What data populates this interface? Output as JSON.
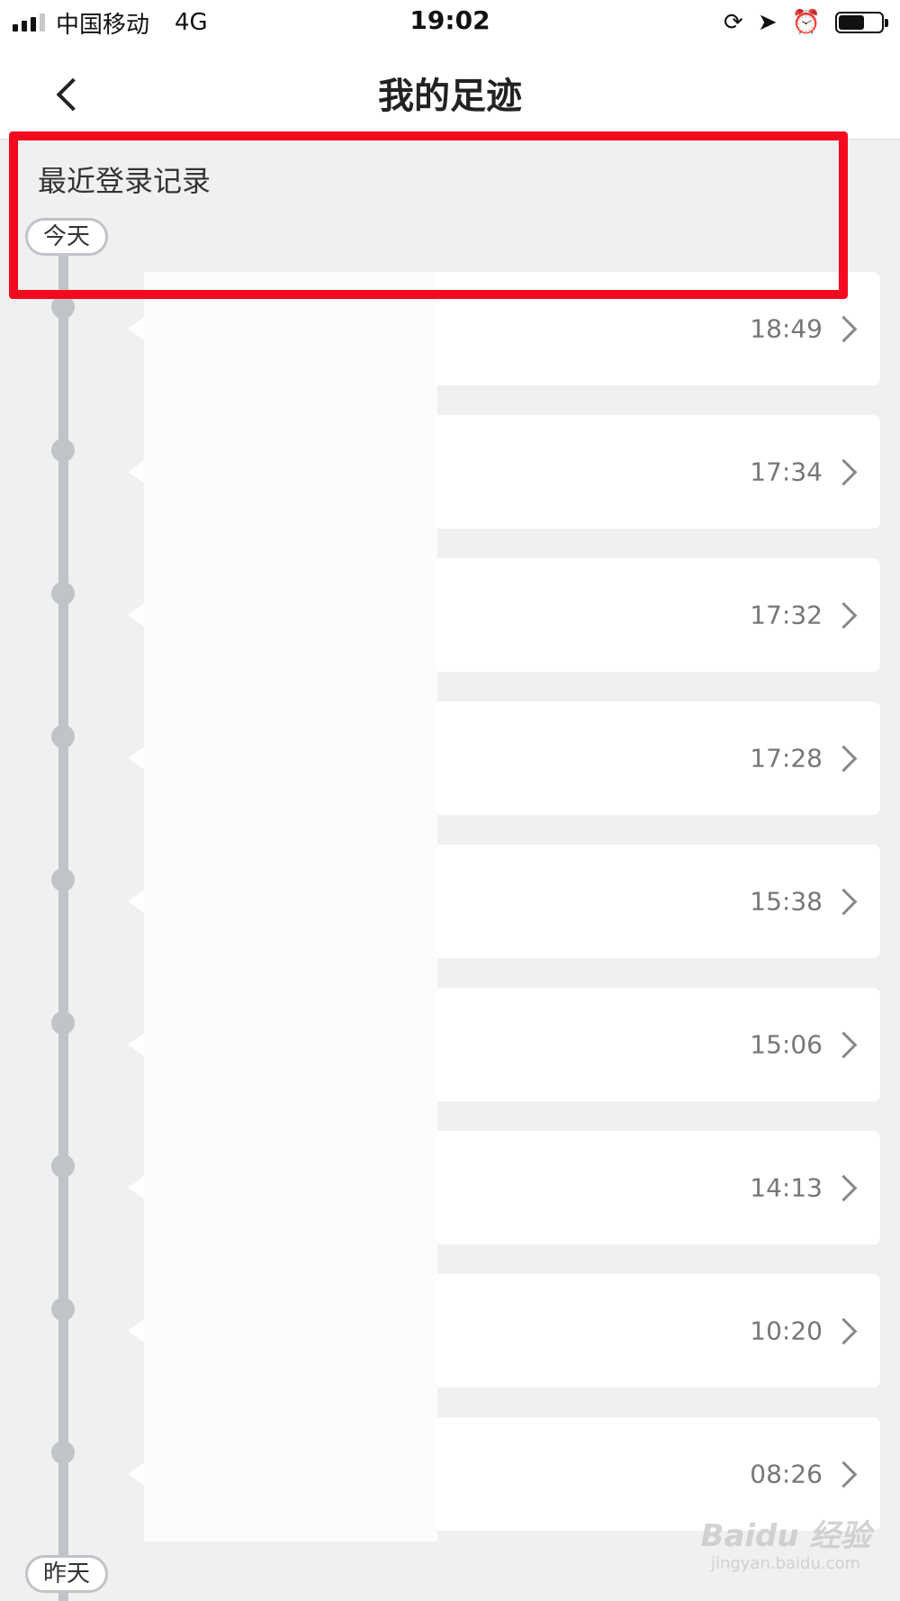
{
  "status_bar": {
    "carrier": "中国移动",
    "network": "4G",
    "time": "19:02",
    "battery_level": 0.6
  },
  "header": {
    "title": "我的足迹"
  },
  "section": {
    "title": "最近登录记录"
  },
  "days": {
    "today": "今天",
    "yesterday": "昨天"
  },
  "records": [
    {
      "time": "18:49"
    },
    {
      "time": "17:34"
    },
    {
      "time": "17:32"
    },
    {
      "time": "17:28"
    },
    {
      "time": "15:38"
    },
    {
      "time": "15:06"
    },
    {
      "time": "14:13"
    },
    {
      "time": "10:20"
    },
    {
      "time": "08:26"
    }
  ],
  "watermark": {
    "logo": "Baidu 经验",
    "sub": "jingyan.baidu.com"
  },
  "colors": {
    "highlight": "#f40a1f",
    "timeline": "#c0c4c9",
    "background": "#f0f0f0"
  }
}
